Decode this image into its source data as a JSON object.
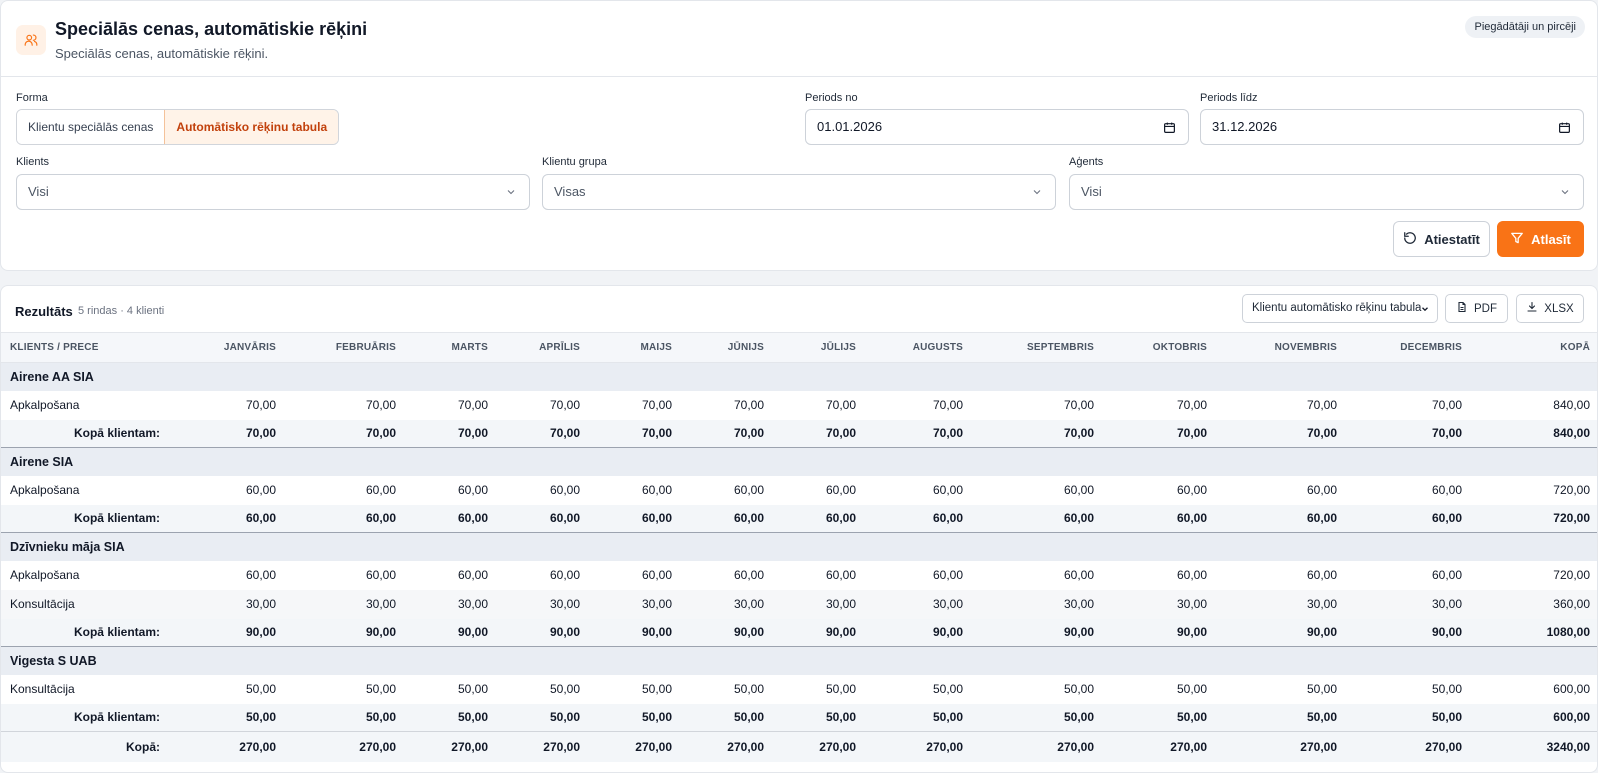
{
  "header": {
    "title": "Speciālās cenas, automātiskie rēķini",
    "subtitle": "Speciālās cenas, automātiskie rēķini.",
    "badge": "Piegādātāji un pircēji",
    "icon": "users-icon"
  },
  "filters": {
    "form_label": "Forma",
    "form_options": [
      "Klientu speciālās cenas",
      "Automātisko rēķinu tabula"
    ],
    "form_active": "Automātisko rēķinu tabula",
    "period_from_label": "Periods no",
    "period_from_value": "01.01.2026",
    "period_to_label": "Periods līdz",
    "period_to_value": "31.12.2026",
    "client_label": "Klients",
    "client_value": "Visi",
    "group_label": "Klientu grupa",
    "group_value": "Visas",
    "agent_label": "Aģents",
    "agent_value": "Visi",
    "reset_label": "Atiestatīt",
    "apply_label": "Atlasīt",
    "accent_color": "#f97316"
  },
  "results": {
    "title": "Rezultāts",
    "meta": "5 rindas · 4 klienti",
    "view_select": "Klientu automātisko rēķinu tabula",
    "pdf_label": "PDF",
    "xlsx_label": "XLSX",
    "columns": [
      "Klients / Prece",
      "Janvāris",
      "Februāris",
      "Marts",
      "Aprīlis",
      "Maijs",
      "Jūnijs",
      "Jūlijs",
      "Augusts",
      "Septembris",
      "Oktobris",
      "Novembris",
      "Decembris",
      "Kopā"
    ],
    "groups": [
      {
        "client": "Airene AA SIA",
        "items": [
          {
            "name": "Apkalpošana",
            "values": [
              "70,00",
              "70,00",
              "70,00",
              "70,00",
              "70,00",
              "70,00",
              "70,00",
              "70,00",
              "70,00",
              "70,00",
              "70,00",
              "70,00",
              "840,00"
            ]
          }
        ],
        "subtotal_label": "Kopā klientam:",
        "subtotal": [
          "70,00",
          "70,00",
          "70,00",
          "70,00",
          "70,00",
          "70,00",
          "70,00",
          "70,00",
          "70,00",
          "70,00",
          "70,00",
          "70,00",
          "840,00"
        ]
      },
      {
        "client": "Airene SIA",
        "items": [
          {
            "name": "Apkalpošana",
            "values": [
              "60,00",
              "60,00",
              "60,00",
              "60,00",
              "60,00",
              "60,00",
              "60,00",
              "60,00",
              "60,00",
              "60,00",
              "60,00",
              "60,00",
              "720,00"
            ]
          }
        ],
        "subtotal_label": "Kopā klientam:",
        "subtotal": [
          "60,00",
          "60,00",
          "60,00",
          "60,00",
          "60,00",
          "60,00",
          "60,00",
          "60,00",
          "60,00",
          "60,00",
          "60,00",
          "60,00",
          "720,00"
        ]
      },
      {
        "client": "Dzīvnieku māja SIA",
        "items": [
          {
            "name": "Apkalpošana",
            "values": [
              "60,00",
              "60,00",
              "60,00",
              "60,00",
              "60,00",
              "60,00",
              "60,00",
              "60,00",
              "60,00",
              "60,00",
              "60,00",
              "60,00",
              "720,00"
            ]
          },
          {
            "name": "Konsultācija",
            "values": [
              "30,00",
              "30,00",
              "30,00",
              "30,00",
              "30,00",
              "30,00",
              "30,00",
              "30,00",
              "30,00",
              "30,00",
              "30,00",
              "30,00",
              "360,00"
            ]
          }
        ],
        "subtotal_label": "Kopā klientam:",
        "subtotal": [
          "90,00",
          "90,00",
          "90,00",
          "90,00",
          "90,00",
          "90,00",
          "90,00",
          "90,00",
          "90,00",
          "90,00",
          "90,00",
          "90,00",
          "1080,00"
        ]
      },
      {
        "client": "Vigesta S UAB",
        "items": [
          {
            "name": "Konsultācija",
            "values": [
              "50,00",
              "50,00",
              "50,00",
              "50,00",
              "50,00",
              "50,00",
              "50,00",
              "50,00",
              "50,00",
              "50,00",
              "50,00",
              "50,00",
              "600,00"
            ]
          }
        ],
        "subtotal_label": "Kopā klientam:",
        "subtotal": [
          "50,00",
          "50,00",
          "50,00",
          "50,00",
          "50,00",
          "50,00",
          "50,00",
          "50,00",
          "50,00",
          "50,00",
          "50,00",
          "50,00",
          "600,00"
        ]
      }
    ],
    "total_label": "Kopā:",
    "total": [
      "270,00",
      "270,00",
      "270,00",
      "270,00",
      "270,00",
      "270,00",
      "270,00",
      "270,00",
      "270,00",
      "270,00",
      "270,00",
      "270,00",
      "3240,00"
    ]
  }
}
